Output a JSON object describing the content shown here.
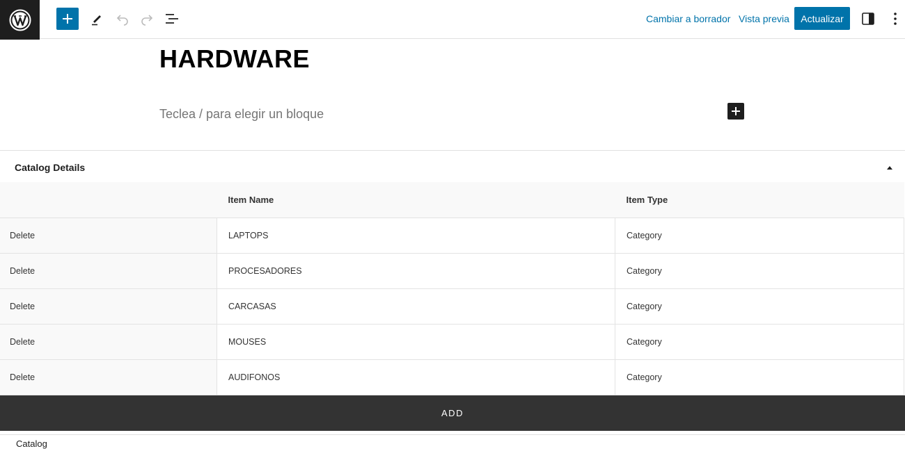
{
  "header": {
    "logo_icon": "wordpress-logo-icon",
    "add_block_icon": "plus-icon",
    "tools_icon": "pencil-icon",
    "undo_icon": "undo-icon",
    "redo_icon": "redo-icon",
    "list_view_icon": "list-view-icon",
    "switch_to_draft_label": "Cambiar a borrador",
    "preview_label": "Vista previa",
    "update_label": "Actualizar",
    "settings_icon": "sidebar-toggle-icon",
    "options_icon": "more-vertical-icon",
    "accent_color": "#0073aa"
  },
  "editor": {
    "post_title": "HARDWARE",
    "block_placeholder": "Teclea / para elegir un bloque",
    "inserter_icon": "plus-icon"
  },
  "metabox": {
    "title": "Catalog Details",
    "toggle_icon": "caret-up-icon",
    "columns": [
      "",
      "Item Name",
      "Item Type"
    ],
    "rows": [
      {
        "action": "Delete",
        "name": "LAPTOPS",
        "type": "Category"
      },
      {
        "action": "Delete",
        "name": "PROCESADORES",
        "type": "Category"
      },
      {
        "action": "Delete",
        "name": "CARCASAS",
        "type": "Category"
      },
      {
        "action": "Delete",
        "name": "MOUSES",
        "type": "Category"
      },
      {
        "action": "Delete",
        "name": "AUDIFONOS",
        "type": "Category"
      }
    ],
    "add_label": "ADD"
  },
  "footer": {
    "breadcrumb": "Catalog"
  }
}
